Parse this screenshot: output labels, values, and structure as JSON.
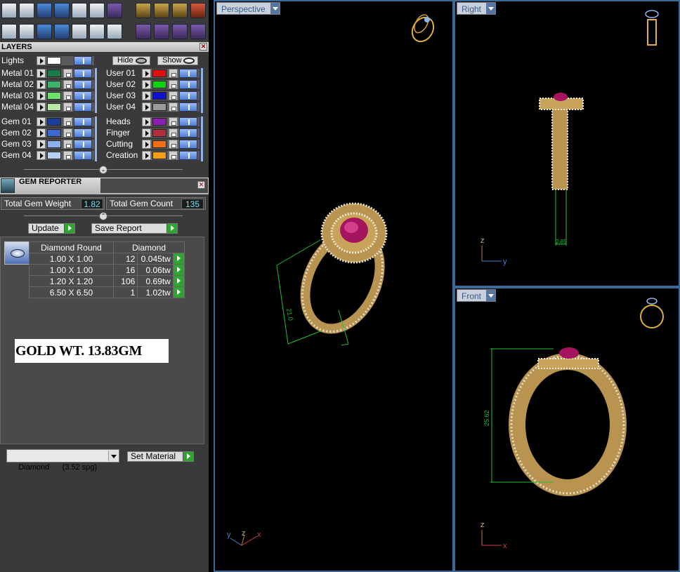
{
  "toolbar": {
    "icons": [
      "settings-icon",
      "wrench-icon",
      "stack-icon",
      "cube-icon",
      "document-icon",
      "edit-icon",
      "blue-cube-icon",
      "brush-icon",
      "frame-icon",
      "frame2-icon",
      "close-frame-icon",
      "grid-icon",
      "monitor-icon",
      "cube-box-icon",
      "book-icon",
      "filter-icon",
      "select-icon",
      "report-icon",
      "gem-icon",
      "gem-rotate-icon",
      "gem-settings-icon",
      "gem-copy-icon"
    ]
  },
  "layers": {
    "title": "LAYERS",
    "lights_label": "Lights",
    "hide_label": "Hide",
    "show_label": "Show",
    "left_rows": [
      {
        "label": "Metal 01",
        "color": "#1a7a4a"
      },
      {
        "label": "Metal 02",
        "color": "#3cb36b"
      },
      {
        "label": "Metal 03",
        "color": "#6be06b"
      },
      {
        "label": "Metal 04",
        "color": "#b8e8a8"
      },
      {
        "label": "Gem 01",
        "color": "#1a3f9a"
      },
      {
        "label": "Gem 02",
        "color": "#3a6ad0"
      },
      {
        "label": "Gem 03",
        "color": "#8ab0f0"
      },
      {
        "label": "Gem 04",
        "color": "#b9d0f5"
      }
    ],
    "right_rows": [
      {
        "label": "User 01",
        "color": "#e01010"
      },
      {
        "label": "User 02",
        "color": "#10d010"
      },
      {
        "label": "User 03",
        "color": "#1010d0"
      },
      {
        "label": "User 04",
        "color": "#9a9a9a"
      },
      {
        "label": "Heads",
        "color": "#8a1fb0"
      },
      {
        "label": "Finger",
        "color": "#b03040"
      },
      {
        "label": "Cutting",
        "color": "#f07010"
      },
      {
        "label": "Creation",
        "color": "#f0a010"
      }
    ]
  },
  "gem_reporter": {
    "title": "GEM REPORTER",
    "total_weight_label": "Total Gem Weight",
    "total_weight_value": "1.82",
    "total_count_label": "Total Gem Count",
    "total_count_value": "135",
    "update_label": "Update",
    "save_report_label": "Save Report",
    "table": {
      "headers": [
        "Diamond Round",
        "Diamond"
      ],
      "rows": [
        {
          "size": "1.00 X 1.00",
          "count": "12",
          "weight": "0.045tw"
        },
        {
          "size": "1.00 X 1.00",
          "count": "16",
          "weight": "0.06tw"
        },
        {
          "size": "1.20 X 1.20",
          "count": "106",
          "weight": "0.69tw"
        },
        {
          "size": "6.50 X 6.50",
          "count": "1",
          "weight": "1.02tw"
        }
      ]
    },
    "gold_weight_text": "GOLD WT. 13.83GM",
    "material_select": "Diamond      (3.52 spg)",
    "set_material_label": "Set Material"
  },
  "viewports": {
    "perspective_label": "Perspective",
    "right_label": "Right",
    "front_label": "Front",
    "dim_perspective": "21.0",
    "dim_right": "2.85",
    "dim_front": "25.62",
    "axis_y": "y",
    "axis_z": "z",
    "axis_x": "x"
  },
  "colors": {
    "gold": "#c9a35a",
    "ruby": "#b0156a",
    "dim_line": "#1fbf2f",
    "viewport_border": "#3a6a9a"
  }
}
